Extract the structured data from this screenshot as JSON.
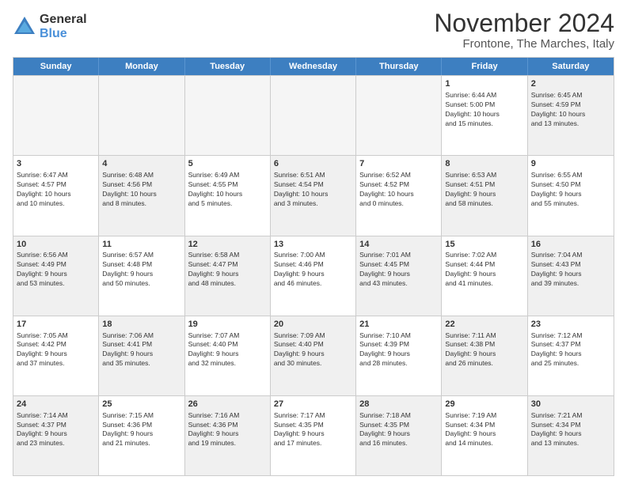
{
  "logo": {
    "general": "General",
    "blue": "Blue"
  },
  "title": "November 2024",
  "subtitle": "Frontone, The Marches, Italy",
  "header_days": [
    "Sunday",
    "Monday",
    "Tuesday",
    "Wednesday",
    "Thursday",
    "Friday",
    "Saturday"
  ],
  "rows": [
    [
      {
        "day": "",
        "info": "",
        "empty": true
      },
      {
        "day": "",
        "info": "",
        "empty": true
      },
      {
        "day": "",
        "info": "",
        "empty": true
      },
      {
        "day": "",
        "info": "",
        "empty": true
      },
      {
        "day": "",
        "info": "",
        "empty": true
      },
      {
        "day": "1",
        "info": "Sunrise: 6:44 AM\nSunset: 5:00 PM\nDaylight: 10 hours\nand 15 minutes."
      },
      {
        "day": "2",
        "info": "Sunrise: 6:45 AM\nSunset: 4:59 PM\nDaylight: 10 hours\nand 13 minutes.",
        "shaded": true
      }
    ],
    [
      {
        "day": "3",
        "info": "Sunrise: 6:47 AM\nSunset: 4:57 PM\nDaylight: 10 hours\nand 10 minutes."
      },
      {
        "day": "4",
        "info": "Sunrise: 6:48 AM\nSunset: 4:56 PM\nDaylight: 10 hours\nand 8 minutes.",
        "shaded": true
      },
      {
        "day": "5",
        "info": "Sunrise: 6:49 AM\nSunset: 4:55 PM\nDaylight: 10 hours\nand 5 minutes."
      },
      {
        "day": "6",
        "info": "Sunrise: 6:51 AM\nSunset: 4:54 PM\nDaylight: 10 hours\nand 3 minutes.",
        "shaded": true
      },
      {
        "day": "7",
        "info": "Sunrise: 6:52 AM\nSunset: 4:52 PM\nDaylight: 10 hours\nand 0 minutes."
      },
      {
        "day": "8",
        "info": "Sunrise: 6:53 AM\nSunset: 4:51 PM\nDaylight: 9 hours\nand 58 minutes.",
        "shaded": true
      },
      {
        "day": "9",
        "info": "Sunrise: 6:55 AM\nSunset: 4:50 PM\nDaylight: 9 hours\nand 55 minutes."
      }
    ],
    [
      {
        "day": "10",
        "info": "Sunrise: 6:56 AM\nSunset: 4:49 PM\nDaylight: 9 hours\nand 53 minutes.",
        "shaded": true
      },
      {
        "day": "11",
        "info": "Sunrise: 6:57 AM\nSunset: 4:48 PM\nDaylight: 9 hours\nand 50 minutes."
      },
      {
        "day": "12",
        "info": "Sunrise: 6:58 AM\nSunset: 4:47 PM\nDaylight: 9 hours\nand 48 minutes.",
        "shaded": true
      },
      {
        "day": "13",
        "info": "Sunrise: 7:00 AM\nSunset: 4:46 PM\nDaylight: 9 hours\nand 46 minutes."
      },
      {
        "day": "14",
        "info": "Sunrise: 7:01 AM\nSunset: 4:45 PM\nDaylight: 9 hours\nand 43 minutes.",
        "shaded": true
      },
      {
        "day": "15",
        "info": "Sunrise: 7:02 AM\nSunset: 4:44 PM\nDaylight: 9 hours\nand 41 minutes."
      },
      {
        "day": "16",
        "info": "Sunrise: 7:04 AM\nSunset: 4:43 PM\nDaylight: 9 hours\nand 39 minutes.",
        "shaded": true
      }
    ],
    [
      {
        "day": "17",
        "info": "Sunrise: 7:05 AM\nSunset: 4:42 PM\nDaylight: 9 hours\nand 37 minutes."
      },
      {
        "day": "18",
        "info": "Sunrise: 7:06 AM\nSunset: 4:41 PM\nDaylight: 9 hours\nand 35 minutes.",
        "shaded": true
      },
      {
        "day": "19",
        "info": "Sunrise: 7:07 AM\nSunset: 4:40 PM\nDaylight: 9 hours\nand 32 minutes."
      },
      {
        "day": "20",
        "info": "Sunrise: 7:09 AM\nSunset: 4:40 PM\nDaylight: 9 hours\nand 30 minutes.",
        "shaded": true
      },
      {
        "day": "21",
        "info": "Sunrise: 7:10 AM\nSunset: 4:39 PM\nDaylight: 9 hours\nand 28 minutes."
      },
      {
        "day": "22",
        "info": "Sunrise: 7:11 AM\nSunset: 4:38 PM\nDaylight: 9 hours\nand 26 minutes.",
        "shaded": true
      },
      {
        "day": "23",
        "info": "Sunrise: 7:12 AM\nSunset: 4:37 PM\nDaylight: 9 hours\nand 25 minutes."
      }
    ],
    [
      {
        "day": "24",
        "info": "Sunrise: 7:14 AM\nSunset: 4:37 PM\nDaylight: 9 hours\nand 23 minutes.",
        "shaded": true
      },
      {
        "day": "25",
        "info": "Sunrise: 7:15 AM\nSunset: 4:36 PM\nDaylight: 9 hours\nand 21 minutes."
      },
      {
        "day": "26",
        "info": "Sunrise: 7:16 AM\nSunset: 4:36 PM\nDaylight: 9 hours\nand 19 minutes.",
        "shaded": true
      },
      {
        "day": "27",
        "info": "Sunrise: 7:17 AM\nSunset: 4:35 PM\nDaylight: 9 hours\nand 17 minutes."
      },
      {
        "day": "28",
        "info": "Sunrise: 7:18 AM\nSunset: 4:35 PM\nDaylight: 9 hours\nand 16 minutes.",
        "shaded": true
      },
      {
        "day": "29",
        "info": "Sunrise: 7:19 AM\nSunset: 4:34 PM\nDaylight: 9 hours\nand 14 minutes."
      },
      {
        "day": "30",
        "info": "Sunrise: 7:21 AM\nSunset: 4:34 PM\nDaylight: 9 hours\nand 13 minutes.",
        "shaded": true
      }
    ]
  ]
}
